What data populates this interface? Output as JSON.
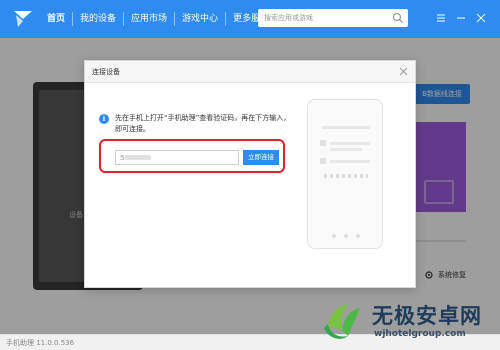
{
  "nav": {
    "items": [
      {
        "label": "首页",
        "active": true
      },
      {
        "label": "我的设备",
        "active": false
      },
      {
        "label": "应用市场",
        "active": false
      },
      {
        "label": "游戏中心",
        "active": false
      },
      {
        "label": "更多服务",
        "active": false
      }
    ]
  },
  "search": {
    "placeholder": "搜索应用或游戏"
  },
  "background": {
    "tablet_text": "设备",
    "button_label": "B数据线连接",
    "system_repair": "系统修复"
  },
  "status": {
    "version": "手机助理 11.0.0.536"
  },
  "dialog": {
    "title": "连接设备",
    "info_text": "先在手机上打开“手机助理”查看验证码，再在下方输入，即可连接。",
    "code_value": "5",
    "connect_label": "立即连接"
  },
  "watermark": {
    "title": "无极安卓网",
    "url": "wjhotelgroup.com"
  },
  "colors": {
    "accent": "#2f8bf0",
    "highlight": "#d6262e",
    "purple": "#a05ee0"
  }
}
